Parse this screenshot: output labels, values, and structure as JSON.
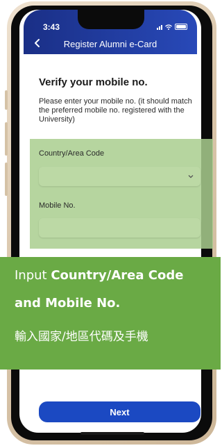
{
  "status_bar": {
    "time": "3:43"
  },
  "header": {
    "title": "Register Alumni e-Card"
  },
  "verify": {
    "title": "Verify your mobile no.",
    "description": "Please enter your mobile no. (it should match the preferred mobile no. registered with the University)"
  },
  "form": {
    "country_code_label": "Country/Area Code",
    "country_code_value": "",
    "mobile_label": "Mobile No.",
    "mobile_value": ""
  },
  "callout": {
    "line1_prefix": "Input ",
    "line1_bold": "Country/Area Code",
    "line2_bold": "and Mobile No.",
    "line3": "輸入國家/地區代碼及手機"
  },
  "buttons": {
    "next_label": "Next"
  },
  "colors": {
    "header_start": "#1a2f86",
    "header_end": "#2849b8",
    "highlight": "#a9ce8e",
    "callout": "#6aaa45",
    "next_button": "#1b49c2"
  }
}
